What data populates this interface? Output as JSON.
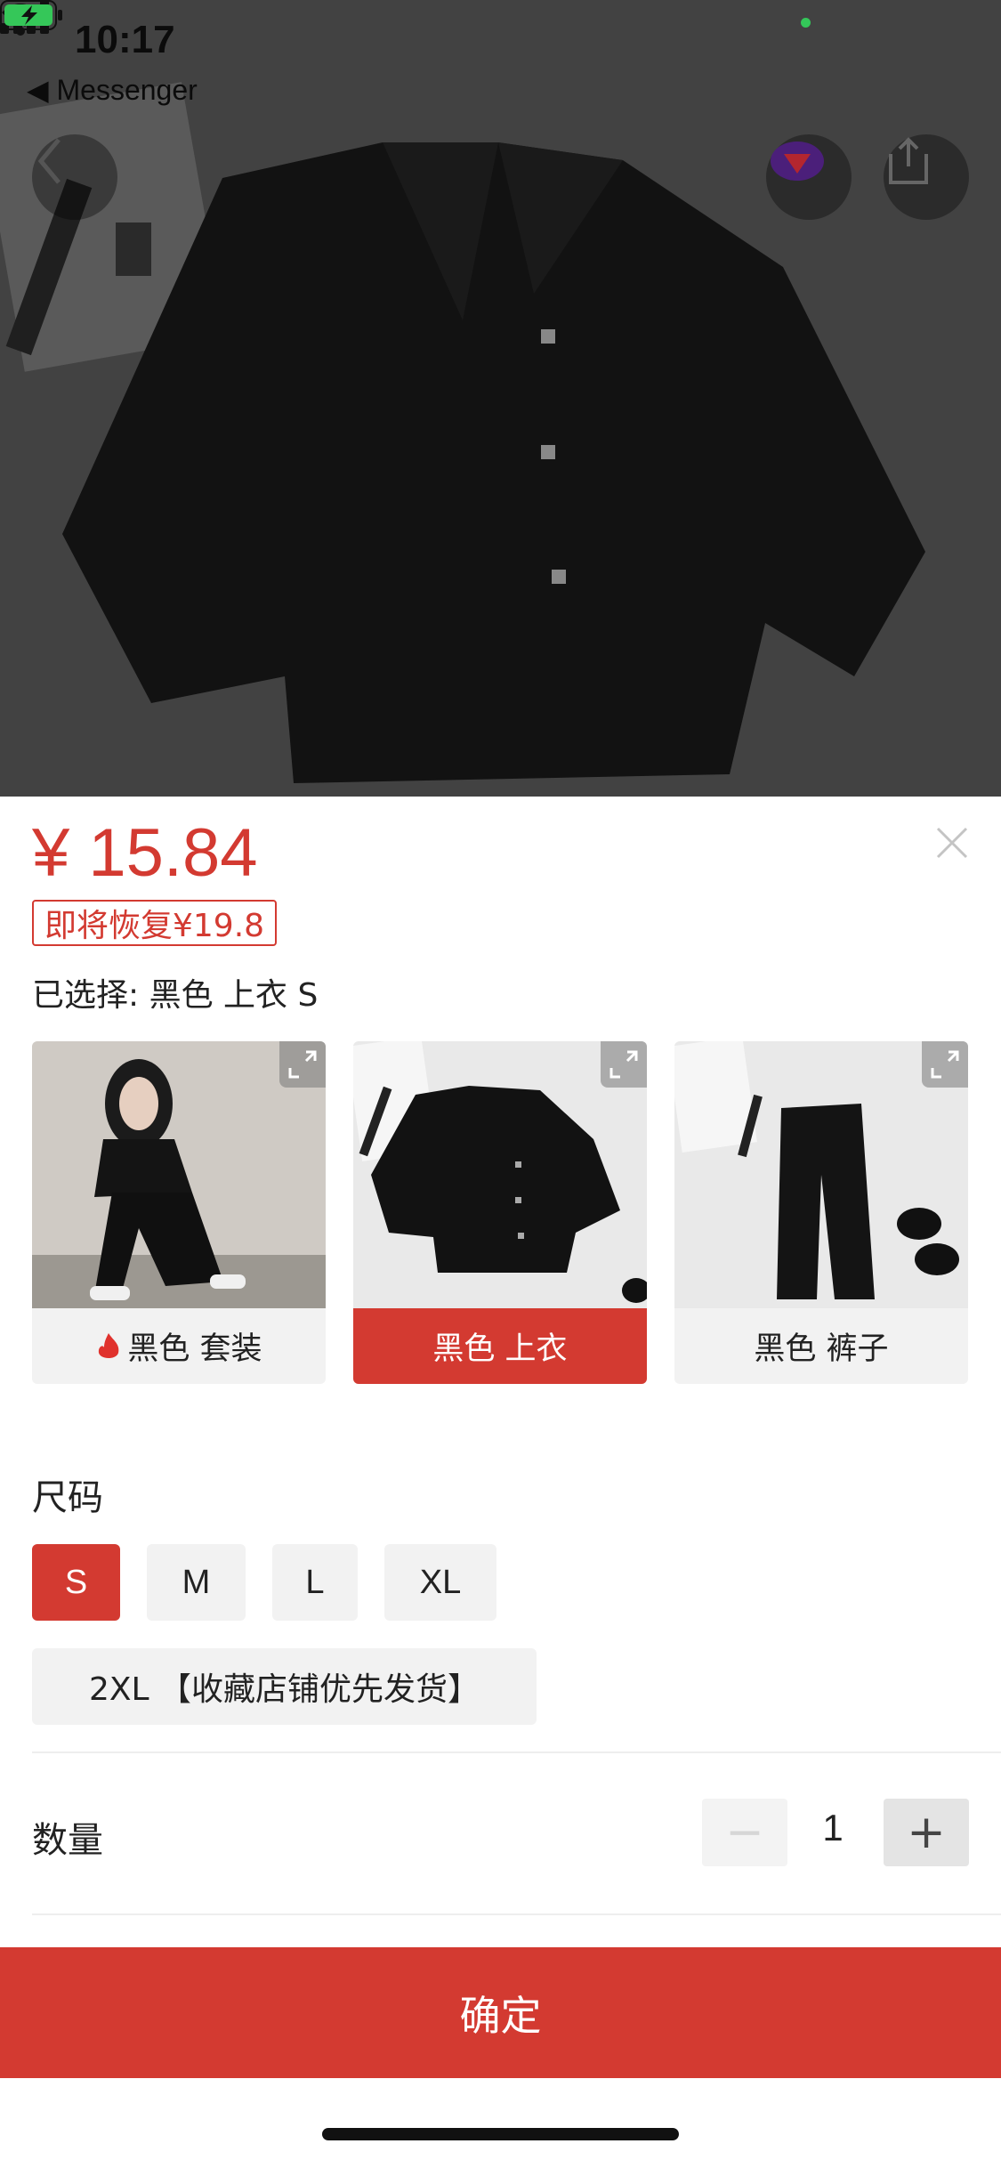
{
  "status_bar": {
    "time": "10:17",
    "back_app": "◀ Messenger"
  },
  "hero": {
    "product_photo": "black short-sleeve shirt on white sheet (dimmed)",
    "back_icon": "chevron-left-icon",
    "share_icon": "share-icon"
  },
  "sheet": {
    "price": "¥ 15.84",
    "restore_tag": "即将恢复¥19.8",
    "selected": "已选择: 黑色 上衣 S",
    "variants": [
      {
        "label": "黑色 套装",
        "hot": true,
        "active": false
      },
      {
        "label": "黑色 上衣",
        "hot": false,
        "active": true
      },
      {
        "label": "黑色 裤子",
        "hot": false,
        "active": false
      }
    ],
    "size_title": "尺码",
    "sizes": [
      "S",
      "M",
      "L",
      "XL",
      "2XL 【收藏店铺优先发货】"
    ],
    "selected_size": "S",
    "quantity_label": "数量",
    "quantity": "1",
    "minus": "−",
    "plus": "+",
    "confirm": "确定"
  },
  "colors": {
    "accent": "#d33a31",
    "chip_bg": "#f2f2f2"
  }
}
